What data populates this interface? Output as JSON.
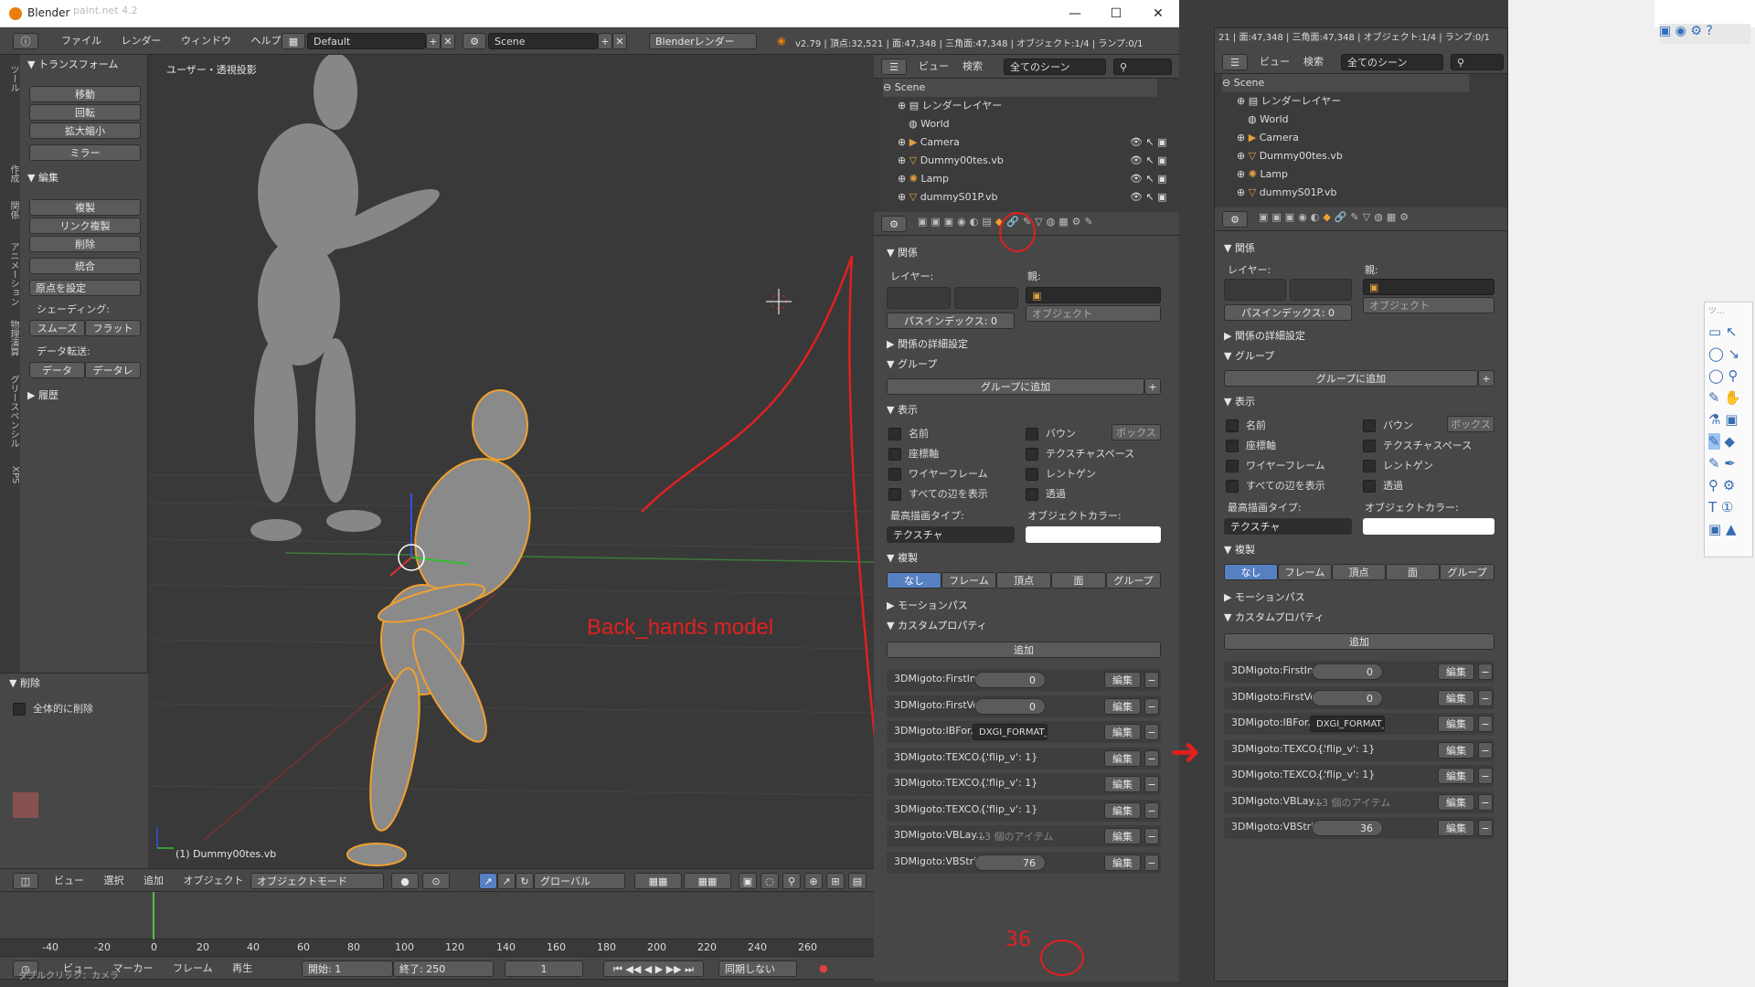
{
  "window": {
    "title": "Blender",
    "behind_title": "paint.net 4.2",
    "controls": [
      "—",
      "☐",
      "✕"
    ]
  },
  "menubar": {
    "items": [
      "ファイル",
      "レンダー",
      "ウィンドウ",
      "ヘルプ"
    ],
    "layout": "Default",
    "scene": "Scene",
    "engine": "Blenderレンダー",
    "stats": "v2.79 | 頂点:32,521 | 面:47,348 | 三角面:47,348 | オブジェクト:1/4 | ランプ:0/1"
  },
  "toolshelf": {
    "tabs": [
      "ツール",
      "作成",
      "関係",
      "アニメーション",
      "物理演算",
      "グリースペンシル",
      "XPS"
    ],
    "transform": {
      "title": "トランスフォーム",
      "buttons": [
        "移動",
        "回転",
        "拡大縮小",
        "ミラー"
      ]
    },
    "edit": {
      "title": "編集",
      "buttons": [
        "複製",
        "リンク複製",
        "削除",
        "統合"
      ],
      "origin": "原点を設定",
      "shading_label": "シェーディング:",
      "shading": [
        "スムーズ",
        "フラット"
      ],
      "transfer_label": "データ転送:",
      "transfer": [
        "データ",
        "データレ"
      ]
    },
    "history": "履歴",
    "delete_panel": {
      "title": "削除",
      "option": "全体的に削除"
    }
  },
  "viewport": {
    "label": "ユーザー・透視投影",
    "object": "(1) Dummy00tes.vb",
    "annotation": "Back_hands model",
    "annotation_color": "#e02020"
  },
  "viewport_header": {
    "items": [
      "ビュー",
      "選択",
      "追加",
      "オブジェクト"
    ],
    "mode": "オブジェクトモード",
    "orientation": "グローバル"
  },
  "timeline": {
    "ticks": [
      "-40",
      "-20",
      "0",
      "20",
      "40",
      "60",
      "80",
      "100",
      "120",
      "140",
      "160",
      "180",
      "200",
      "220",
      "240",
      "260"
    ],
    "menu": [
      "ビュー",
      "マーカー",
      "フレーム",
      "再生"
    ],
    "start": "開始:",
    "start_val": "1",
    "end": "終了:",
    "end_val": "250",
    "frame": "1",
    "sync": "同期しない",
    "status": "ダブルクリック：カメラ"
  },
  "outliner": {
    "menu": [
      "ビュー",
      "検索"
    ],
    "filter": "全てのシーン",
    "items": [
      "Scene",
      "レンダーレイヤー",
      "World",
      "Camera",
      "Dummy00tes.vb",
      "Lamp",
      "dummyS01P.vb"
    ]
  },
  "properties": {
    "relations": "関係",
    "layer": "レイヤー:",
    "parent": "親:",
    "parent_type": "オブジェクト",
    "pass_index": "パスインデックス:",
    "pass_val": "0",
    "relations_extra": "関係の詳細設定",
    "groups": "グループ",
    "add_group": "グループに追加",
    "display": "表示",
    "opts_left": [
      "名前",
      "座標軸",
      "ワイヤーフレーム",
      "すべての辺を表示"
    ],
    "opts_right": [
      "バウン",
      "テクスチャスペース",
      "レントゲン",
      "透過"
    ],
    "bounds_type": "ボックス",
    "max_draw": "最高描画タイプ:",
    "draw_type": "テクスチャ",
    "obj_color": "オブジェクトカラー:",
    "dupli": "複製",
    "dupli_opts": [
      "なし",
      "フレーム",
      "頂点",
      "面",
      "グループ"
    ],
    "motion": "モーションパス",
    "custom": "カスタムプロパティ",
    "add": "追加",
    "edit": "編集",
    "props": [
      {
        "name": "3DMigoto:FirstIn...",
        "val": "0",
        "kind": "num"
      },
      {
        "name": "3DMigoto:FirstVe",
        "val": "0",
        "kind": "num"
      },
      {
        "name": "3DMigoto:IBFor...",
        "val": "DXGI_FORMAT_...",
        "kind": "field"
      },
      {
        "name": "3DMigoto:TEXCO...",
        "val": "{'flip_v': 1}",
        "kind": "text"
      },
      {
        "name": "3DMigoto:TEXCO...",
        "val": "{'flip_v': 1}",
        "kind": "text"
      },
      {
        "name": "3DMigoto:TEXCO...",
        "val": "{'flip_v': 1}",
        "kind": "text"
      },
      {
        "name": "3DMigoto:VBLay...",
        "val": "13 個のアイテム",
        "kind": "muted"
      },
      {
        "name": "3DMigoto:VBStride",
        "val": "76",
        "kind": "num"
      }
    ]
  },
  "right_panel": {
    "stats": "21 | 面:47,348 | 三角面:47,348 | オブジェクト:1/4 | ランプ:0/1",
    "props": [
      {
        "name": "3DMigoto:FirstIn...",
        "val": "0",
        "kind": "num"
      },
      {
        "name": "3DMigoto:FirstVe",
        "val": "0",
        "kind": "num"
      },
      {
        "name": "3DMigoto:IBFor...",
        "val": "DXGI_FORMAT_...",
        "kind": "field"
      },
      {
        "name": "3DMigoto:TEXCO...",
        "val": "{'flip_v': 1}",
        "kind": "text"
      },
      {
        "name": "3DMigoto:TEXCO...",
        "val": "{'flip_v': 1}",
        "kind": "text"
      },
      {
        "name": "3DMigoto:VBLay...",
        "val": "13 個のアイテム",
        "kind": "muted"
      },
      {
        "name": "3DMigoto:VBStride",
        "val": "36",
        "kind": "num"
      }
    ]
  },
  "annotations": {
    "number": "36"
  },
  "paintnet": {
    "tools_title": "ツ..."
  }
}
